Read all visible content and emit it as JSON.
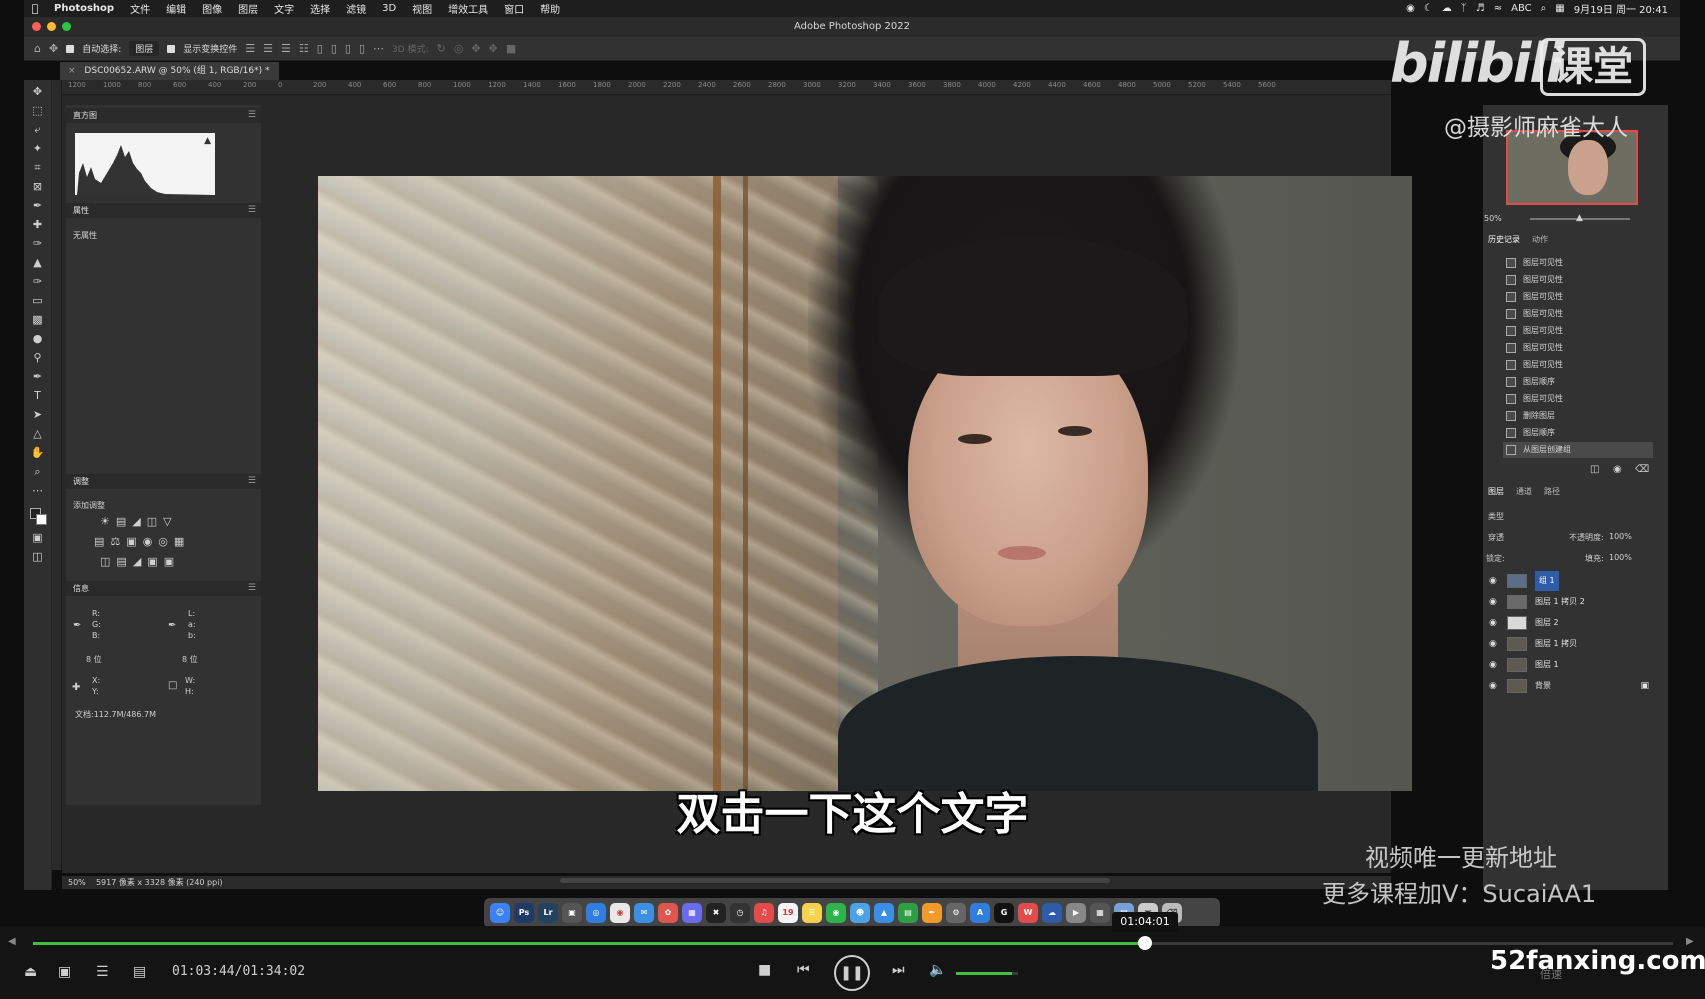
{
  "menubar": {
    "app_name": "Photoshop",
    "menus": [
      "文件",
      "编辑",
      "图像",
      "图层",
      "文字",
      "选择",
      "滤镜",
      "3D",
      "视图",
      "增效工具",
      "窗口",
      "帮助"
    ],
    "input_method": "ABC",
    "datetime": "9月19日 周一  20:41"
  },
  "window": {
    "title": "Adobe Photoshop 2022"
  },
  "optionsbar": {
    "auto_select_label": "自动选择:",
    "auto_select_value": "图层",
    "show_transform_label": "显示变换控件",
    "mode_3d_label": "3D 模式:"
  },
  "document": {
    "tab_title": "DSC00652.ARW @ 50% (组 1, RGB/16*) *"
  },
  "ruler_ticks": [
    "1200",
    "1000",
    "800",
    "600",
    "400",
    "200",
    "0",
    "200",
    "400",
    "600",
    "800",
    "1000",
    "1200",
    "1400",
    "1600",
    "1800",
    "2000",
    "2200",
    "2400",
    "2600",
    "2800",
    "3000",
    "3200",
    "3400",
    "3600",
    "3800",
    "4000",
    "4200",
    "4400",
    "4600",
    "4800",
    "5000",
    "5200",
    "5400",
    "5600"
  ],
  "left_panels": {
    "histogram_title": "直方图",
    "properties_title": "属性",
    "properties_empty": "无属性",
    "adjustments_title": "调整",
    "adjustments_add": "添加调整",
    "info_title": "信息",
    "info_labels": {
      "r": "R:",
      "g": "G:",
      "b": "B:",
      "l": "L:",
      "a": "a:",
      "bb": "b:",
      "bits1": "8 位",
      "bits2": "8 位",
      "x": "X:",
      "y": "Y:",
      "w": "W:",
      "h": "H:"
    },
    "doc_size": "文档:112.7M/486.7M"
  },
  "statusbar": {
    "zoom": "50%",
    "info": "5917 像素 x 3328 像素 (240 ppi)"
  },
  "navigator": {
    "zoom": "50%"
  },
  "history_panel": {
    "tabs": [
      "历史记录",
      "动作"
    ],
    "items": [
      "图层可见性",
      "图层可见性",
      "图层可见性",
      "图层可见性",
      "图层可见性",
      "图层可见性",
      "图层可见性",
      "图层顺序",
      "图层可见性",
      "删除图层",
      "图层顺序",
      "从图层创建组"
    ]
  },
  "layers_panel": {
    "tabs": [
      "图层",
      "通道",
      "路径"
    ],
    "filter_kind": "类型",
    "blend_mode": "穿透",
    "opacity_label": "不透明度:",
    "opacity_value": "100%",
    "lock_label": "锁定:",
    "fill_label": "填充:",
    "fill_value": "100%",
    "layers": [
      {
        "name": "组 1",
        "selected": true
      },
      {
        "name": "图层 1 拷贝 2",
        "selected": false
      },
      {
        "name": "图层 2",
        "selected": false
      },
      {
        "name": "图层 1 拷贝",
        "selected": false
      },
      {
        "name": "图层 1",
        "selected": false
      },
      {
        "name": "背景",
        "selected": false
      }
    ]
  },
  "overlay": {
    "subtitle": "双击一下这个文字",
    "logo_text": "bilibili",
    "logo_badge": "课堂",
    "author": "@摄影师麻雀大人",
    "promo_line1": "视频唯一更新地址",
    "promo_line2": "更多课程加V：SucaiAA1",
    "site": "52fanxing.com"
  },
  "player": {
    "hover_time": "01:04:01",
    "timecode": "01:03:44/01:34:02",
    "progress_fraction": 0.678,
    "volume_fraction": 0.9,
    "speed_label": "倍速"
  },
  "colors": {
    "accent_green": "#3fbf3f",
    "selection_blue": "#2f5ca8",
    "nav_frame": "#e34b4b"
  }
}
